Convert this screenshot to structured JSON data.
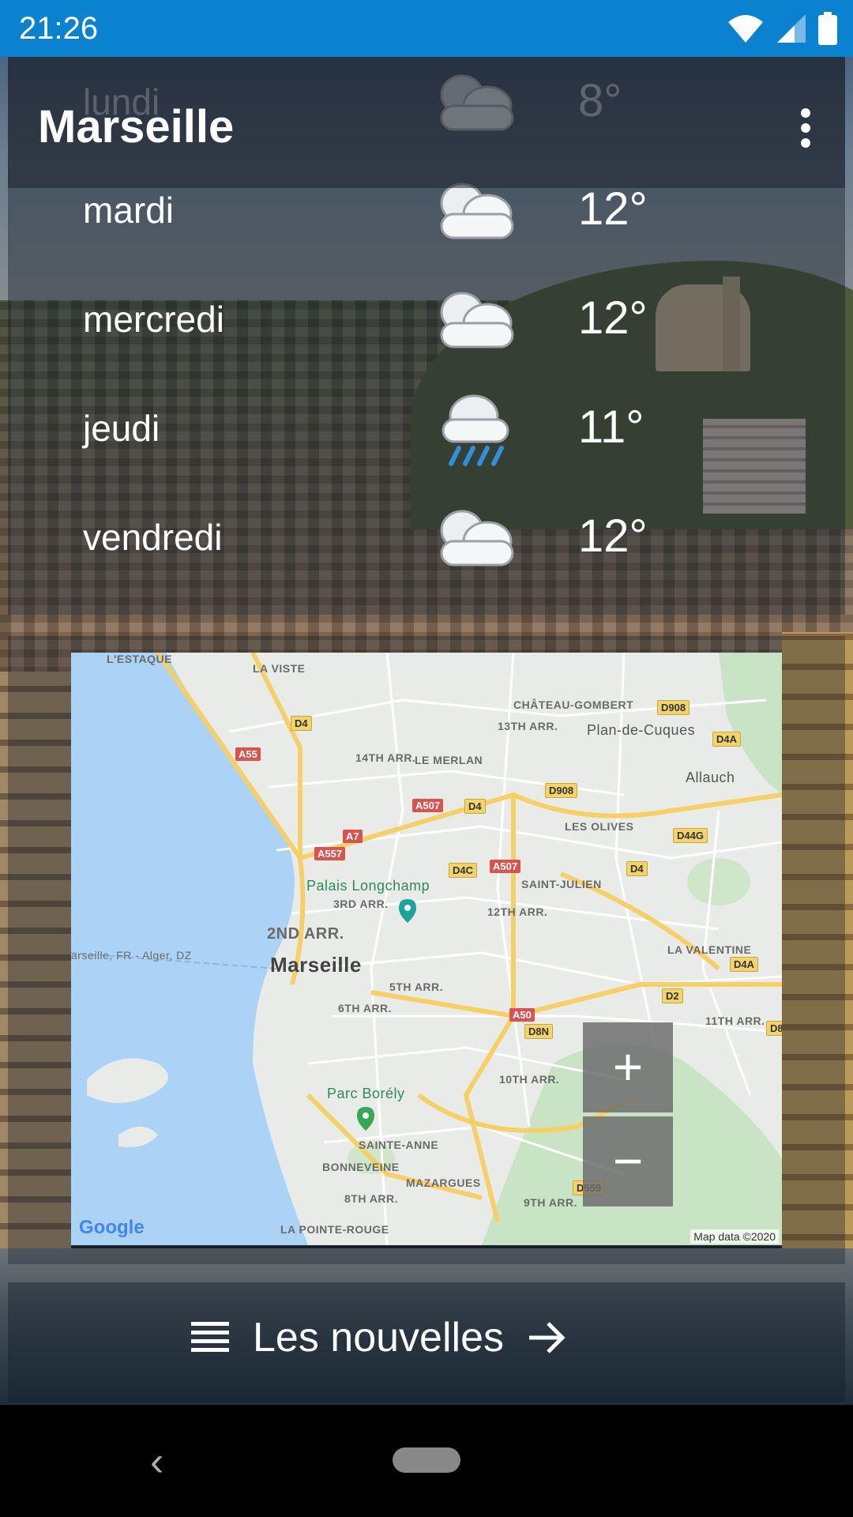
{
  "status_bar": {
    "time": "21:26",
    "icons": [
      "wifi-icon",
      "signal-icon",
      "battery-icon"
    ]
  },
  "toolbar": {
    "city": "Marseille",
    "menu_icon": "more-vert-icon"
  },
  "forecast": [
    {
      "day": "lundi",
      "icon": "cloud-icon",
      "temp": "8°"
    },
    {
      "day": "mardi",
      "icon": "cloud-icon",
      "temp": "12°"
    },
    {
      "day": "mercredi",
      "icon": "cloud-icon",
      "temp": "12°"
    },
    {
      "day": "jeudi",
      "icon": "rain-icon",
      "temp": "11°"
    },
    {
      "day": "vendredi",
      "icon": "cloud-icon",
      "temp": "12°"
    }
  ],
  "map": {
    "labels": [
      "L'ESTAQUE",
      "LA VISTE",
      "CHÂTEAU-GOMBERT",
      "13TH ARR.",
      "Plan-de-Cuques",
      "14TH ARR.",
      "LE MERLAN",
      "Allauch",
      "LES OLIVES",
      "SAINT-JULIEN",
      "Palais Longchamp",
      "3RD ARR.",
      "12TH ARR.",
      "2ND ARR.",
      "Marseille",
      "arseille, FR - Alger, DZ",
      "LA VALENTINE",
      "5TH ARR.",
      "6TH ARR.",
      "11TH ARR.",
      "10TH ARR.",
      "Parc Borély",
      "SAINTE-ANNE",
      "BONNEVEINE",
      "MAZARGUES",
      "8TH ARR.",
      "9TH ARR.",
      "LA POINTE-ROUGE"
    ],
    "roads": [
      "D908",
      "D4A",
      "D4",
      "A55",
      "A507",
      "D4",
      "D908",
      "A7",
      "A557",
      "D4C",
      "A507",
      "D44G",
      "D4",
      "D4A",
      "D2",
      "A50",
      "D8N",
      "D559",
      "D8"
    ],
    "zoom_in": "+",
    "zoom_out": "−",
    "google": "Google",
    "attribution": "Map data ©2020"
  },
  "news": {
    "label": "Les nouvelles",
    "list_icon": "list-icon",
    "arrow_icon": "arrow-right-icon"
  },
  "navbar": {
    "back": "‹"
  }
}
